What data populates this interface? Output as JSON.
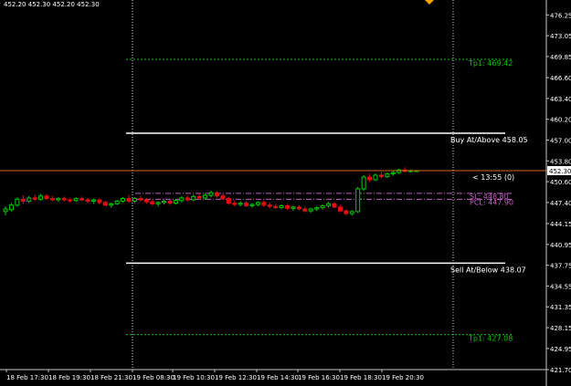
{
  "header": {
    "ohlc_text": "452.20 452.30 452.20 452.30"
  },
  "colors": {
    "background": "#000000",
    "axis": "#c8c8c8",
    "grid_separator": "#dcdcdc",
    "bull": "#00cc00",
    "bear": "#e01010",
    "level_line": "#ffffff",
    "tp_line": "#00c800",
    "current_price_line": "#d2691e",
    "pivot_line": "#c060c0",
    "marker": "#ffa500"
  },
  "chart_data": {
    "type": "candlestick",
    "title": "",
    "xlabel": "",
    "ylabel": "",
    "grid": false,
    "ylim": [
      421.7,
      477.7
    ],
    "y_ticks": [
      "476.25",
      "473.05",
      "469.85",
      "466.60",
      "463.40",
      "460.20",
      "457.00",
      "453.80",
      "450.60",
      "447.40",
      "444.15",
      "440.95",
      "437.75",
      "434.55",
      "431.35",
      "428.15",
      "424.95",
      "421.70"
    ],
    "x_ticks": [
      "18 Feb 17:30",
      "18 Feb 19:30",
      "18 Feb 21:30",
      "19 Feb 08:30",
      "19 Feb 10:30",
      "19 Feb 12:30",
      "19 Feb 14:30",
      "19 Feb 16:30",
      "19 Feb 18:30",
      "19 Feb 20:30"
    ],
    "session_separators": [
      "19 Feb 08:30",
      "19 Feb 21:30"
    ],
    "current_price": {
      "value": 452.3,
      "label": "452.30"
    },
    "countdown_label": "< 13:55 (0)",
    "levels": [
      {
        "name": "Tp1",
        "value": 469.42,
        "label": "Tp1: 469.42",
        "style": "dotted",
        "kind": "tp"
      },
      {
        "name": "Buy At/Above",
        "value": 458.05,
        "label": "Buy At/Above 458.05",
        "style": "solid",
        "kind": "entry"
      },
      {
        "name": "SL",
        "value": 448.8,
        "label": "SL: 448.80",
        "style": "dashdot",
        "kind": "pivot"
      },
      {
        "name": "PCL",
        "value": 447.9,
        "label": "PCL: 447.90",
        "style": "dashdot",
        "kind": "pivot"
      },
      {
        "name": "Sell At/Below",
        "value": 438.07,
        "label": "Sell At/Below 438.07",
        "style": "solid",
        "kind": "entry"
      },
      {
        "name": "Tp1",
        "value": 427.08,
        "label": "Tp1: 427.08",
        "style": "dotted",
        "kind": "tp"
      }
    ],
    "candles": [
      {
        "o": 446.0,
        "h": 446.8,
        "l": 445.4,
        "c": 446.4
      },
      {
        "o": 446.3,
        "h": 447.3,
        "l": 446.0,
        "c": 447.0
      },
      {
        "o": 447.0,
        "h": 448.2,
        "l": 446.7,
        "c": 447.9
      },
      {
        "o": 447.9,
        "h": 448.5,
        "l": 447.2,
        "c": 447.6
      },
      {
        "o": 447.6,
        "h": 448.4,
        "l": 447.3,
        "c": 448.1
      },
      {
        "o": 448.1,
        "h": 448.6,
        "l": 447.6,
        "c": 447.9
      },
      {
        "o": 447.9,
        "h": 448.7,
        "l": 447.7,
        "c": 448.4
      },
      {
        "o": 448.4,
        "h": 448.7,
        "l": 447.8,
        "c": 448.0
      },
      {
        "o": 448.0,
        "h": 448.4,
        "l": 447.6,
        "c": 447.8
      },
      {
        "o": 447.8,
        "h": 448.2,
        "l": 447.5,
        "c": 448.0
      },
      {
        "o": 448.0,
        "h": 448.3,
        "l": 447.6,
        "c": 447.8
      },
      {
        "o": 447.8,
        "h": 448.0,
        "l": 447.4,
        "c": 447.7
      },
      {
        "o": 447.7,
        "h": 448.2,
        "l": 447.5,
        "c": 448.0
      },
      {
        "o": 448.0,
        "h": 448.3,
        "l": 447.6,
        "c": 447.8
      },
      {
        "o": 447.8,
        "h": 448.1,
        "l": 447.3,
        "c": 447.6
      },
      {
        "o": 447.6,
        "h": 448.0,
        "l": 447.2,
        "c": 447.8
      },
      {
        "o": 447.8,
        "h": 448.0,
        "l": 447.1,
        "c": 447.4
      },
      {
        "o": 447.4,
        "h": 447.7,
        "l": 446.8,
        "c": 447.0
      },
      {
        "o": 447.0,
        "h": 447.4,
        "l": 446.6,
        "c": 447.2
      },
      {
        "o": 447.2,
        "h": 447.8,
        "l": 447.0,
        "c": 447.6
      },
      {
        "o": 447.6,
        "h": 448.2,
        "l": 447.4,
        "c": 448.0
      },
      {
        "o": 448.0,
        "h": 448.6,
        "l": 447.4,
        "c": 447.6
      },
      {
        "o": 447.6,
        "h": 448.2,
        "l": 447.3,
        "c": 448.0
      },
      {
        "o": 448.0,
        "h": 448.4,
        "l": 447.6,
        "c": 447.8
      },
      {
        "o": 447.8,
        "h": 448.1,
        "l": 447.2,
        "c": 447.5
      },
      {
        "o": 447.5,
        "h": 447.8,
        "l": 446.9,
        "c": 447.2
      },
      {
        "o": 447.2,
        "h": 447.6,
        "l": 446.8,
        "c": 447.4
      },
      {
        "o": 447.4,
        "h": 447.9,
        "l": 447.1,
        "c": 447.6
      },
      {
        "o": 447.6,
        "h": 447.9,
        "l": 447.0,
        "c": 447.3
      },
      {
        "o": 447.3,
        "h": 447.9,
        "l": 447.1,
        "c": 447.7
      },
      {
        "o": 447.7,
        "h": 448.4,
        "l": 447.4,
        "c": 448.1
      },
      {
        "o": 448.1,
        "h": 448.5,
        "l": 447.5,
        "c": 447.8
      },
      {
        "o": 447.8,
        "h": 448.6,
        "l": 447.6,
        "c": 448.3
      },
      {
        "o": 448.3,
        "h": 448.8,
        "l": 447.8,
        "c": 448.1
      },
      {
        "o": 448.1,
        "h": 448.8,
        "l": 447.8,
        "c": 448.5
      },
      {
        "o": 448.5,
        "h": 449.2,
        "l": 448.2,
        "c": 448.9
      },
      {
        "o": 448.9,
        "h": 449.2,
        "l": 448.1,
        "c": 448.4
      },
      {
        "o": 448.4,
        "h": 448.8,
        "l": 447.8,
        "c": 448.0
      },
      {
        "o": 448.0,
        "h": 448.3,
        "l": 447.0,
        "c": 447.3
      },
      {
        "o": 447.3,
        "h": 447.7,
        "l": 446.8,
        "c": 447.1
      },
      {
        "o": 447.1,
        "h": 447.6,
        "l": 446.8,
        "c": 447.3
      },
      {
        "o": 447.3,
        "h": 447.6,
        "l": 446.7,
        "c": 446.9
      },
      {
        "o": 446.9,
        "h": 447.3,
        "l": 446.6,
        "c": 447.1
      },
      {
        "o": 447.1,
        "h": 447.6,
        "l": 446.8,
        "c": 447.4
      },
      {
        "o": 447.4,
        "h": 447.7,
        "l": 446.7,
        "c": 447.0
      },
      {
        "o": 447.0,
        "h": 447.4,
        "l": 446.5,
        "c": 446.8
      },
      {
        "o": 446.8,
        "h": 447.2,
        "l": 446.4,
        "c": 446.6
      },
      {
        "o": 446.6,
        "h": 447.1,
        "l": 446.4,
        "c": 446.9
      },
      {
        "o": 446.9,
        "h": 447.2,
        "l": 446.3,
        "c": 446.5
      },
      {
        "o": 446.5,
        "h": 446.9,
        "l": 446.1,
        "c": 446.7
      },
      {
        "o": 446.7,
        "h": 447.0,
        "l": 446.2,
        "c": 446.4
      },
      {
        "o": 446.4,
        "h": 446.8,
        "l": 445.9,
        "c": 446.1
      },
      {
        "o": 446.1,
        "h": 446.6,
        "l": 445.8,
        "c": 446.4
      },
      {
        "o": 446.4,
        "h": 446.8,
        "l": 446.1,
        "c": 446.6
      },
      {
        "o": 446.6,
        "h": 447.1,
        "l": 446.3,
        "c": 446.9
      },
      {
        "o": 446.9,
        "h": 447.5,
        "l": 446.6,
        "c": 447.2
      },
      {
        "o": 447.2,
        "h": 447.5,
        "l": 446.5,
        "c": 446.7
      },
      {
        "o": 446.7,
        "h": 447.0,
        "l": 445.9,
        "c": 446.1
      },
      {
        "o": 446.1,
        "h": 446.4,
        "l": 445.4,
        "c": 445.7
      },
      {
        "o": 445.7,
        "h": 446.2,
        "l": 445.4,
        "c": 446.0
      },
      {
        "o": 446.0,
        "h": 449.8,
        "l": 445.8,
        "c": 449.5
      },
      {
        "o": 449.5,
        "h": 451.6,
        "l": 449.2,
        "c": 451.3
      },
      {
        "o": 451.3,
        "h": 451.8,
        "l": 450.6,
        "c": 450.9
      },
      {
        "o": 450.9,
        "h": 451.9,
        "l": 450.7,
        "c": 451.6
      },
      {
        "o": 451.6,
        "h": 452.1,
        "l": 451.1,
        "c": 451.4
      },
      {
        "o": 451.4,
        "h": 452.0,
        "l": 451.2,
        "c": 451.8
      },
      {
        "o": 451.8,
        "h": 452.3,
        "l": 451.5,
        "c": 452.0
      },
      {
        "o": 452.0,
        "h": 452.6,
        "l": 451.8,
        "c": 452.4
      },
      {
        "o": 452.4,
        "h": 452.8,
        "l": 452.0,
        "c": 452.2
      },
      {
        "o": 452.2,
        "h": 452.5,
        "l": 452.0,
        "c": 452.3
      },
      {
        "o": 452.3,
        "h": 452.4,
        "l": 452.1,
        "c": 452.3
      }
    ]
  }
}
